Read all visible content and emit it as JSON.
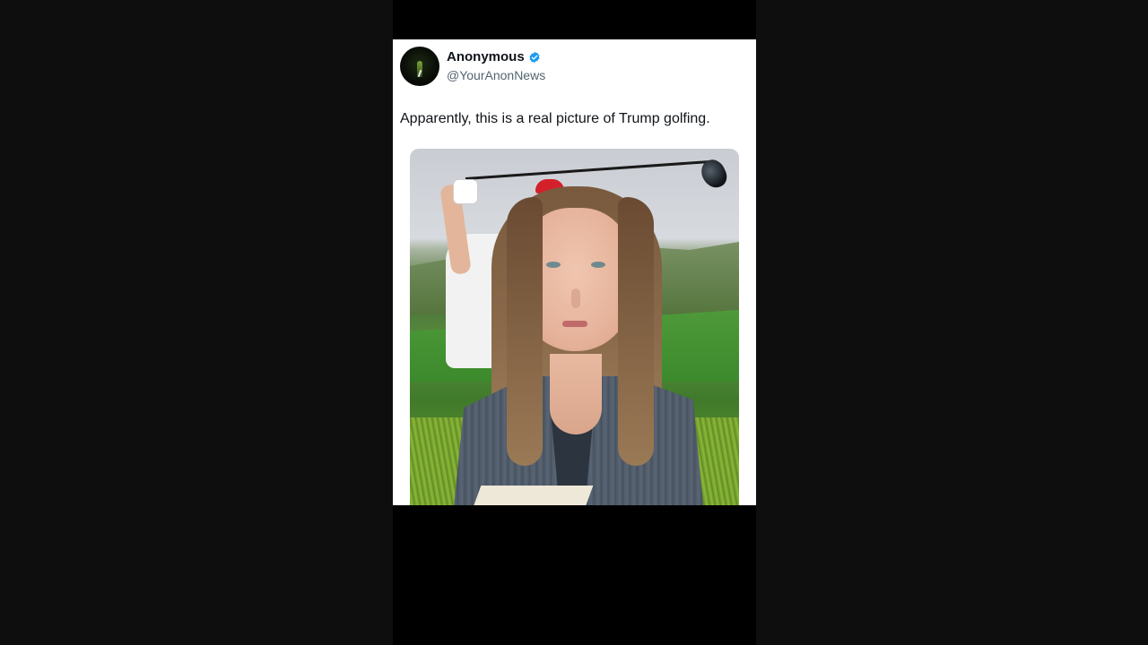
{
  "tweet": {
    "author": {
      "display_name": "Anonymous",
      "handle": "@YourAnonNews",
      "verified": true,
      "avatar_icon": "anonymous-mask-avatar"
    },
    "text": "Apparently, this is a real picture of Trump golfing.",
    "media": {
      "description_icon": "golf-photo-with-overlay"
    }
  },
  "colors": {
    "background": "#0e0e0e",
    "card": "#ffffff",
    "name_text": "#0f1419",
    "handle_text": "#536471",
    "verified_badge": "#1d9bf0"
  }
}
